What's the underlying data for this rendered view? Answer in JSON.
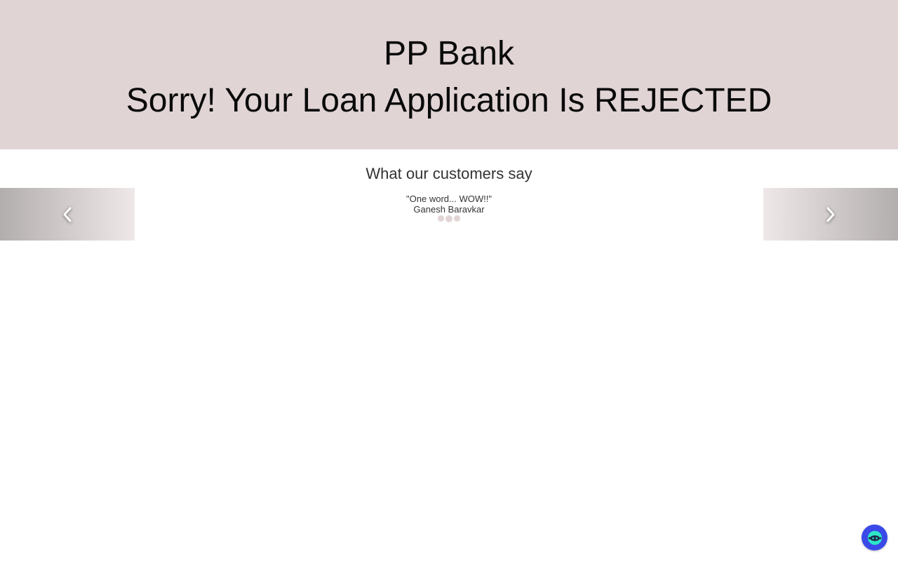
{
  "header": {
    "bank_name": "PP Bank",
    "status_message": "Sorry! Your Loan Application Is REJECTED"
  },
  "testimonials": {
    "title": "What our customers say",
    "quote": "\"One word... WOW!!\"",
    "author": "Ganesh Baravkar",
    "slide_count": 3,
    "active_index": 1
  },
  "controls": {
    "prev_icon": "chevron-left-icon",
    "next_icon": "chevron-right-icon"
  },
  "chat": {
    "icon": "chatbot-icon"
  },
  "colors": {
    "header_background": "#e1d4d4",
    "indicator": "#e1d4d4",
    "chat_button": "#3a49e8",
    "chat_icon_face": "#2ee6c8"
  }
}
